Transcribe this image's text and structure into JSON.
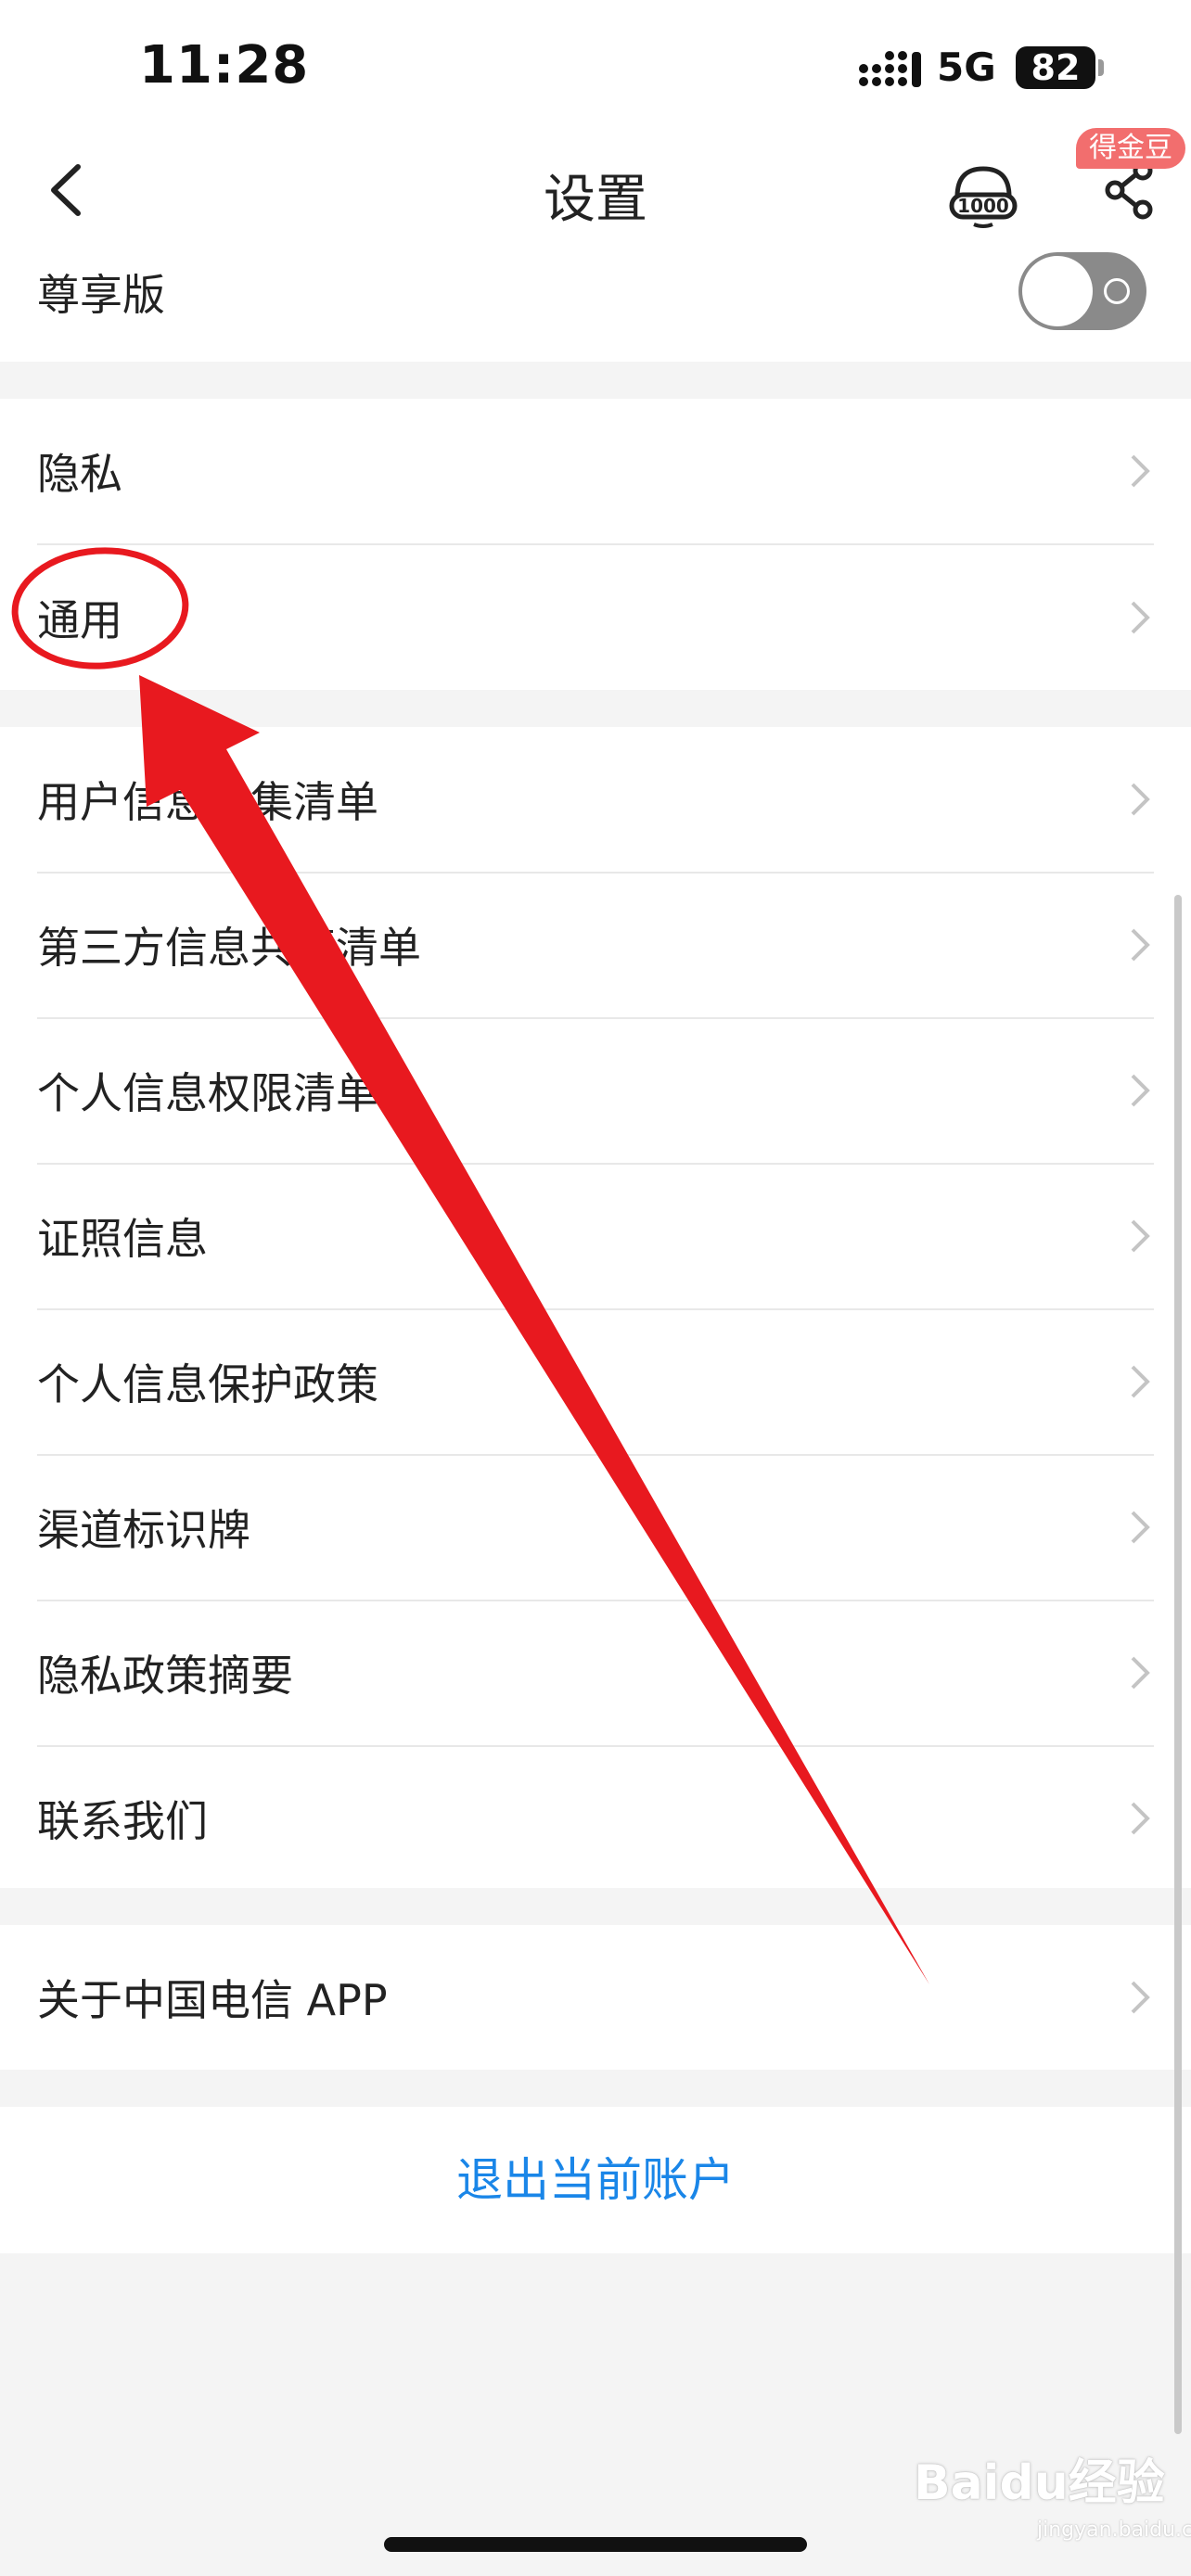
{
  "status_bar": {
    "time": "11:28",
    "network": "5G",
    "battery": "82"
  },
  "nav": {
    "title": "设置",
    "badge": "得金豆",
    "icons": [
      "back-icon",
      "customer-service-icon",
      "share-icon"
    ]
  },
  "premium": {
    "label": "尊享版",
    "enabled": false
  },
  "group1": [
    {
      "label": "隐私"
    },
    {
      "label": "通用"
    }
  ],
  "group2": [
    {
      "label": "用户信息收集清单"
    },
    {
      "label": "第三方信息共享清单"
    },
    {
      "label": "个人信息权限清单"
    },
    {
      "label": "证照信息"
    },
    {
      "label": "个人信息保护政策"
    },
    {
      "label": "渠道标识牌"
    },
    {
      "label": "隐私政策摘要"
    },
    {
      "label": "联系我们"
    }
  ],
  "group3": [
    {
      "label": "关于中国电信 APP"
    }
  ],
  "logout_label": "退出当前账户",
  "watermark": {
    "main": "Baidu经验",
    "sub": "jingyan.baidu.com"
  },
  "colors": {
    "accent": "#1a86e8",
    "badge": "#f26e6e",
    "annotation": "#e8191f"
  }
}
